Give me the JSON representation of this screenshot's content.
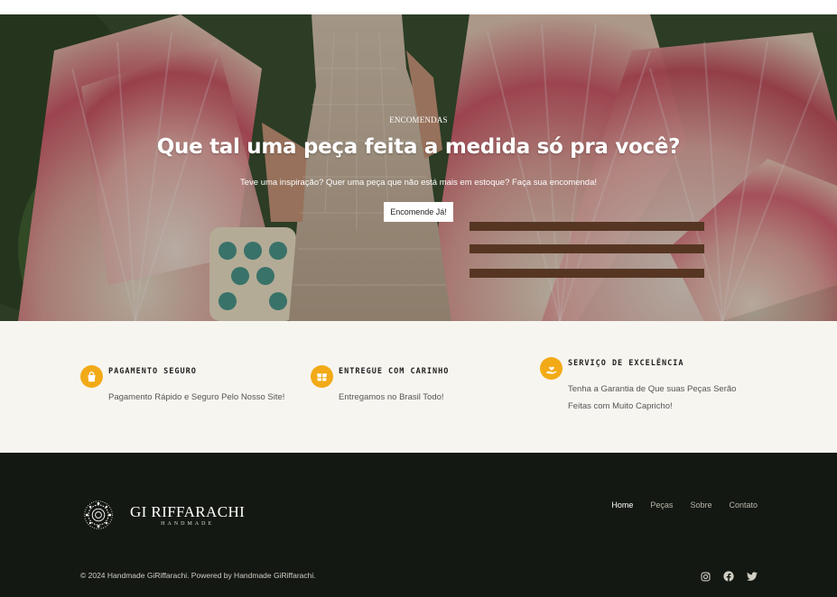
{
  "hero": {
    "eyebrow": "ENCOMENDAS",
    "title": "Que tal uma peça feita a medida só pra você?",
    "subtitle": "Teve uma inspiração? Quer uma peça que não está mais em estoque? Faça sua encomenda!",
    "cta_label": "Encomende Já!"
  },
  "features": [
    {
      "icon": "shopping-bag-icon",
      "title": "PAGAMENTO SEGURO",
      "text": "Pagamento Rápido e Seguro Pelo Nosso Site!"
    },
    {
      "icon": "gift-box-icon",
      "title": "ENTREGUE COM CARINHO",
      "text": "Entregamos no Brasil Todo!"
    },
    {
      "icon": "hand-heart-icon",
      "title": "SERVIÇO DE EXCELÊNCIA",
      "text": "Tenha a Garantia de Que suas Peças Serão Feitas com Muito Capricho!"
    }
  ],
  "footer": {
    "logo_name": "GI RIFFARACHI",
    "logo_sub": "HANDMADE",
    "nav": [
      "Home",
      "Peças",
      "Sobre",
      "Contato"
    ],
    "active_nav": "Home",
    "copyright": "© 2024 Handmade GiRiffarachi. Powered by Handmade GiRiffarachi.",
    "social": [
      "instagram-icon",
      "facebook-icon",
      "twitter-icon"
    ]
  },
  "colors": {
    "accent": "#f2aa16",
    "features_bg": "#f7f5f0",
    "footer_bg": "#141812"
  }
}
